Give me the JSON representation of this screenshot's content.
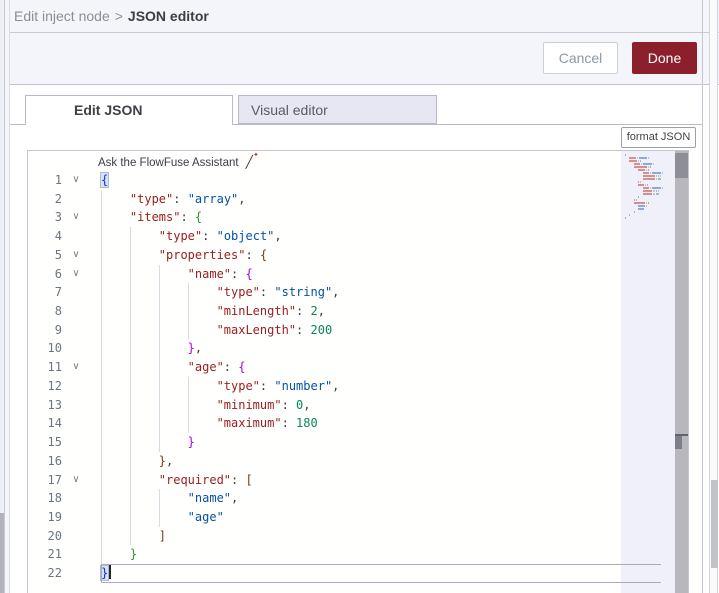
{
  "breadcrumb": {
    "parent": "Edit inject node",
    "separator": ">",
    "current": "JSON editor"
  },
  "actions": {
    "cancel": "Cancel",
    "done": "Done"
  },
  "tabs": [
    {
      "label": "Edit JSON",
      "active": true
    },
    {
      "label": "Visual editor",
      "active": false
    }
  ],
  "toolbar": {
    "format_label": "format JSON"
  },
  "assistant": {
    "label": "Ask the FlowFuse Assistant",
    "icon": "wand-sparkle-icon"
  },
  "colors": {
    "done_button": "#8c1f2c",
    "tray_header_bg": "#f4f4fb",
    "inactive_tab_bg": "#e7e7f3",
    "json_key": "#9b1c1c",
    "json_string": "#0451a5",
    "json_number": "#098658",
    "bracket_depth_colors": [
      "#0431fa",
      "#319331",
      "#7b3814",
      "#af00db"
    ]
  },
  "editor": {
    "language": "json",
    "line_count": 22,
    "cursor_line": 22,
    "lines": [
      {
        "n": 1,
        "fold": true,
        "indent": 0,
        "tokens": [
          {
            "c": "b1 match",
            "v": "{"
          }
        ]
      },
      {
        "n": 2,
        "indent": 1,
        "tokens": [
          {
            "c": "key",
            "v": "\"type\""
          },
          {
            "c": "pn",
            "v": ": "
          },
          {
            "c": "str",
            "v": "\"array\""
          },
          {
            "c": "pn",
            "v": ","
          }
        ]
      },
      {
        "n": 3,
        "fold": true,
        "indent": 1,
        "tokens": [
          {
            "c": "key",
            "v": "\"items\""
          },
          {
            "c": "pn",
            "v": ": "
          },
          {
            "c": "b2",
            "v": "{"
          }
        ]
      },
      {
        "n": 4,
        "indent": 2,
        "tokens": [
          {
            "c": "key",
            "v": "\"type\""
          },
          {
            "c": "pn",
            "v": ": "
          },
          {
            "c": "str",
            "v": "\"object\""
          },
          {
            "c": "pn",
            "v": ","
          }
        ]
      },
      {
        "n": 5,
        "fold": true,
        "indent": 2,
        "tokens": [
          {
            "c": "key",
            "v": "\"properties\""
          },
          {
            "c": "pn",
            "v": ": "
          },
          {
            "c": "b3",
            "v": "{"
          }
        ]
      },
      {
        "n": 6,
        "fold": true,
        "indent": 3,
        "tokens": [
          {
            "c": "key",
            "v": "\"name\""
          },
          {
            "c": "pn",
            "v": ": "
          },
          {
            "c": "b4",
            "v": "{"
          }
        ]
      },
      {
        "n": 7,
        "indent": 4,
        "tokens": [
          {
            "c": "key",
            "v": "\"type\""
          },
          {
            "c": "pn",
            "v": ": "
          },
          {
            "c": "str",
            "v": "\"string\""
          },
          {
            "c": "pn",
            "v": ","
          }
        ]
      },
      {
        "n": 8,
        "indent": 4,
        "tokens": [
          {
            "c": "key",
            "v": "\"minLength\""
          },
          {
            "c": "pn",
            "v": ": "
          },
          {
            "c": "num",
            "v": "2"
          },
          {
            "c": "pn",
            "v": ","
          }
        ]
      },
      {
        "n": 9,
        "indent": 4,
        "tokens": [
          {
            "c": "key",
            "v": "\"maxLength\""
          },
          {
            "c": "pn",
            "v": ": "
          },
          {
            "c": "num",
            "v": "200"
          }
        ]
      },
      {
        "n": 10,
        "indent": 3,
        "tokens": [
          {
            "c": "b4",
            "v": "}"
          },
          {
            "c": "pn",
            "v": ","
          }
        ]
      },
      {
        "n": 11,
        "fold": true,
        "indent": 3,
        "tokens": [
          {
            "c": "key",
            "v": "\"age\""
          },
          {
            "c": "pn",
            "v": ": "
          },
          {
            "c": "b4",
            "v": "{"
          }
        ]
      },
      {
        "n": 12,
        "indent": 4,
        "tokens": [
          {
            "c": "key",
            "v": "\"type\""
          },
          {
            "c": "pn",
            "v": ": "
          },
          {
            "c": "str",
            "v": "\"number\""
          },
          {
            "c": "pn",
            "v": ","
          }
        ]
      },
      {
        "n": 13,
        "indent": 4,
        "tokens": [
          {
            "c": "key",
            "v": "\"minimum\""
          },
          {
            "c": "pn",
            "v": ": "
          },
          {
            "c": "num",
            "v": "0"
          },
          {
            "c": "pn",
            "v": ","
          }
        ]
      },
      {
        "n": 14,
        "indent": 4,
        "tokens": [
          {
            "c": "key",
            "v": "\"maximum\""
          },
          {
            "c": "pn",
            "v": ": "
          },
          {
            "c": "num",
            "v": "180"
          }
        ]
      },
      {
        "n": 15,
        "indent": 3,
        "tokens": [
          {
            "c": "b4",
            "v": "}"
          }
        ]
      },
      {
        "n": 16,
        "indent": 2,
        "tokens": [
          {
            "c": "b3",
            "v": "}"
          },
          {
            "c": "pn",
            "v": ","
          }
        ]
      },
      {
        "n": 17,
        "fold": true,
        "indent": 2,
        "tokens": [
          {
            "c": "key",
            "v": "\"required\""
          },
          {
            "c": "pn",
            "v": ": "
          },
          {
            "c": "b3",
            "v": "["
          }
        ]
      },
      {
        "n": 18,
        "indent": 3,
        "tokens": [
          {
            "c": "str",
            "v": "\"name\""
          },
          {
            "c": "pn",
            "v": ","
          }
        ]
      },
      {
        "n": 19,
        "indent": 3,
        "tokens": [
          {
            "c": "str",
            "v": "\"age\""
          }
        ]
      },
      {
        "n": 20,
        "indent": 2,
        "tokens": [
          {
            "c": "b3",
            "v": "]"
          }
        ]
      },
      {
        "n": 21,
        "indent": 1,
        "tokens": [
          {
            "c": "b2",
            "v": "}"
          }
        ]
      },
      {
        "n": 22,
        "indent": 0,
        "current": true,
        "cursor": true,
        "tokens": [
          {
            "c": "b1 match",
            "v": "}"
          }
        ]
      }
    ]
  }
}
